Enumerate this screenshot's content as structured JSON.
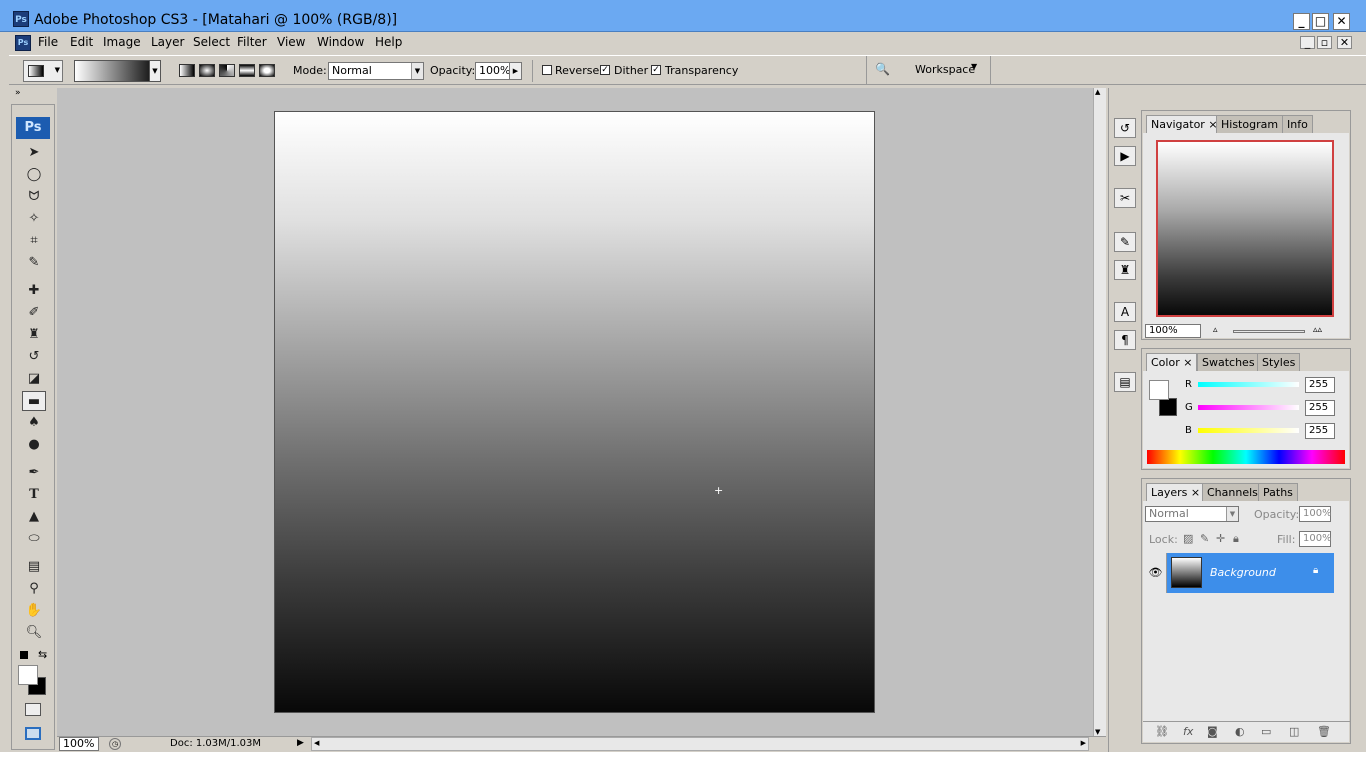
{
  "window": {
    "title": "Adobe Photoshop CS3 - [Matahari @ 100% (RGB/8)]",
    "app_icon": "Ps"
  },
  "menu": [
    "File",
    "Edit",
    "Image",
    "Layer",
    "Select",
    "Filter",
    "View",
    "Window",
    "Help"
  ],
  "options": {
    "mode_label": "Mode:",
    "mode_value": "Normal",
    "opacity_label": "Opacity:",
    "opacity_value": "100%",
    "reverse_label": "Reverse",
    "reverse_checked": false,
    "dither_label": "Dither",
    "dither_checked": true,
    "transparency_label": "Transparency",
    "transparency_checked": true,
    "workspace_label": "Workspace"
  },
  "toolbox": {
    "logo": "Ps"
  },
  "status": {
    "zoom": "100%",
    "doc": "Doc: 1.03M/1.03M"
  },
  "navigator": {
    "tabs": [
      "Navigator",
      "Histogram",
      "Info"
    ],
    "zoom": "100%"
  },
  "color": {
    "tabs": [
      "Color",
      "Swatches",
      "Styles"
    ],
    "r_label": "R",
    "g_label": "G",
    "b_label": "B",
    "r": "255",
    "g": "255",
    "b": "255"
  },
  "layers": {
    "tabs": [
      "Layers",
      "Channels",
      "Paths"
    ],
    "blend": "Normal",
    "opacity_label": "Opacity:",
    "opacity": "100%",
    "lock_label": "Lock:",
    "fill_label": "Fill:",
    "fill": "100%",
    "layer_name": "Background"
  }
}
